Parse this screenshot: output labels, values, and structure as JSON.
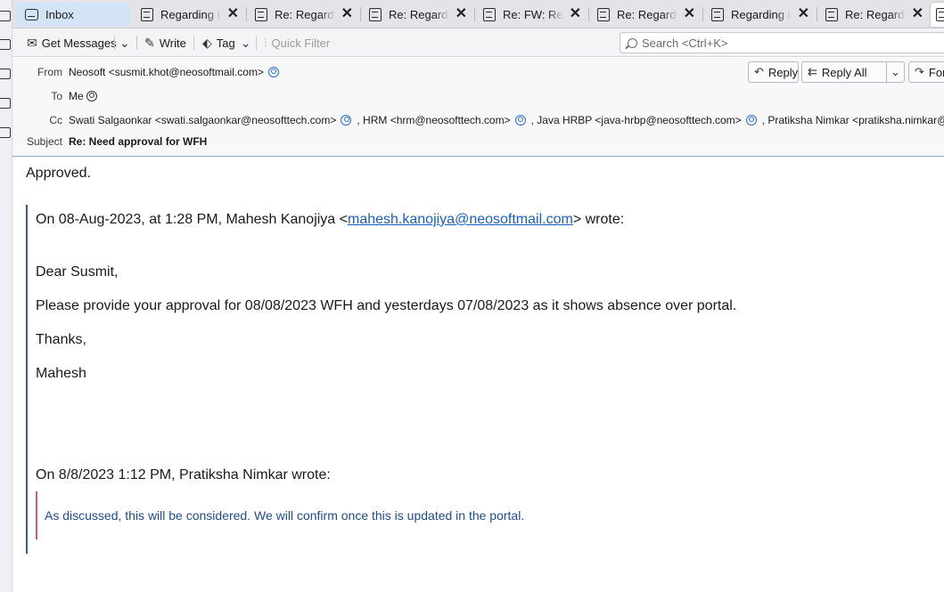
{
  "tabs": [
    {
      "label": "Inbox",
      "kind": "inbox"
    },
    {
      "label": "Regarding inv",
      "kind": "message"
    },
    {
      "label": "Re: Regarding",
      "kind": "message"
    },
    {
      "label": "Re: Regarding",
      "kind": "message"
    },
    {
      "label": "Re: FW: Regarding",
      "kind": "message"
    },
    {
      "label": "Re: Regarding",
      "kind": "message"
    },
    {
      "label": "Regarding inv",
      "kind": "message"
    },
    {
      "label": "Re: Regarding",
      "kind": "message"
    }
  ],
  "toolbar": {
    "get_messages": "Get Messages",
    "write": "Write",
    "tag": "Tag",
    "quick_filter": "Quick Filter",
    "search_placeholder": "Search <Ctrl+K>"
  },
  "header": {
    "from_label": "From",
    "from_value": "Neosoft <susmit.khot@neosoftmail.com>",
    "to_label": "To",
    "to_value": "Me",
    "cc_label": "Cc",
    "cc": [
      "Swati Salgaonkar <swati.salgaonkar@neosofttech.com>",
      ", HRM <hrm@neosofttech.com>",
      ", Java HRBP <java-hrbp@neosofttech.com>",
      ", Pratiksha Nimkar <pratiksha.nimkar@neo"
    ],
    "subject_label": "Subject",
    "subject_value": "Re: Need approval for WFH",
    "reply": "Reply",
    "reply_all": "Reply All",
    "forward": "Forwar"
  },
  "message": {
    "approved": "Approved.",
    "quote_intro_pre": "On 08-Aug-2023, at 1:28 PM, Mahesh Kanojiya <",
    "quote_intro_email": "mahesh.kanojiya@neosoftmail.com",
    "quote_intro_post": "> wrote:",
    "greeting": "Dear Susmit,",
    "request": "Please provide your approval for  08/08/2023 WFH and yesterdays 07/08/2023  as it shows absence over portal.",
    "thanks": "Thanks,",
    "signature": "Mahesh",
    "inner_intro": "On 8/8/2023 1:12 PM, Pratiksha Nimkar wrote:",
    "inner_text": "As discussed, this will be considered. We will confirm once this is updated in the portal."
  },
  "colors": {
    "accent": "#2a5db0",
    "link": "#1a5fbf",
    "inner_quote_border": "#c05a86",
    "inner_quote_text": "#1f4c8a"
  }
}
